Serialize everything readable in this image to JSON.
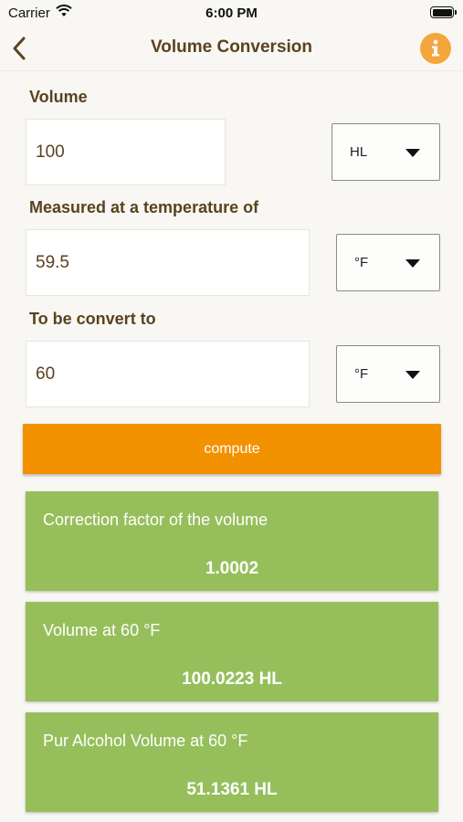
{
  "status": {
    "carrier": "Carrier",
    "time": "6:00 PM"
  },
  "nav": {
    "title": "Volume Conversion"
  },
  "volume": {
    "label": "Volume",
    "value": "100",
    "unit": "HL"
  },
  "measured": {
    "label": "Measured at a temperature of",
    "value": "59.5",
    "unit": "°F"
  },
  "convert": {
    "label": "To be convert to",
    "value": "60",
    "unit": "°F"
  },
  "compute_label": "compute",
  "results": [
    {
      "title": "Correction factor of the volume",
      "value": "1.0002"
    },
    {
      "title": "Volume at 60 °F",
      "value": "100.0223 HL"
    },
    {
      "title": "Pur Alcohol Volume at 60 °F",
      "value": "51.1361 HL"
    }
  ],
  "colors": {
    "accent": "#f39200",
    "card": "#96bf5c",
    "info": "#f4a53c",
    "text": "#5a4220"
  },
  "icons": {
    "back": "chevron-left-icon",
    "info": "info-icon",
    "wifi": "wifi-icon",
    "battery": "battery-icon",
    "dropdown": "caret-down-icon"
  }
}
